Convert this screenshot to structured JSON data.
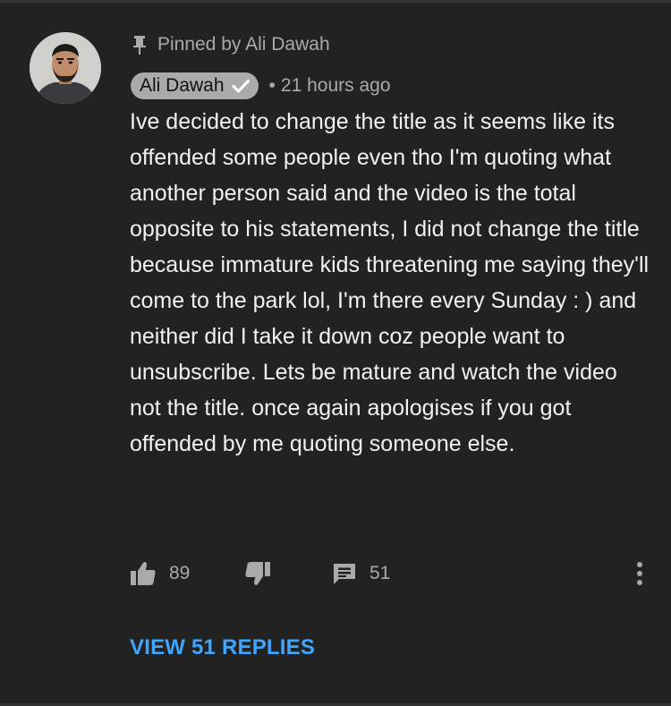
{
  "comment": {
    "pinned_label": "Pinned by Ali Dawah",
    "author": "Ali Dawah",
    "separator": "•",
    "timestamp": "21 hours ago",
    "text": "Ive decided to change the title as it seems like its offended some people even tho I'm quoting what another person said and the video is the total opposite to his statements, I did not change the title because immature kids threatening me saying they'll come to the park lol, I'm there every Sunday : ) and neither did I take it down coz people want to unsubscribe. Lets be mature and watch the video not the title. once again apologises if you got offended by me quoting someone else.",
    "likes": "89",
    "replies_count": "51",
    "view_replies_label": "VIEW 51 REPLIES"
  },
  "icons": {
    "pin": "pin-icon",
    "verified": "checkmark-icon",
    "like": "thumbs-up-icon",
    "dislike": "thumbs-down-icon",
    "reply": "comment-icon",
    "more": "more-vertical-icon"
  },
  "colors": {
    "background": "#222222",
    "text": "#f1f1f1",
    "secondary": "#aaaaaa",
    "link": "#3ea6ff",
    "author_chip": "#aaaaaa"
  }
}
